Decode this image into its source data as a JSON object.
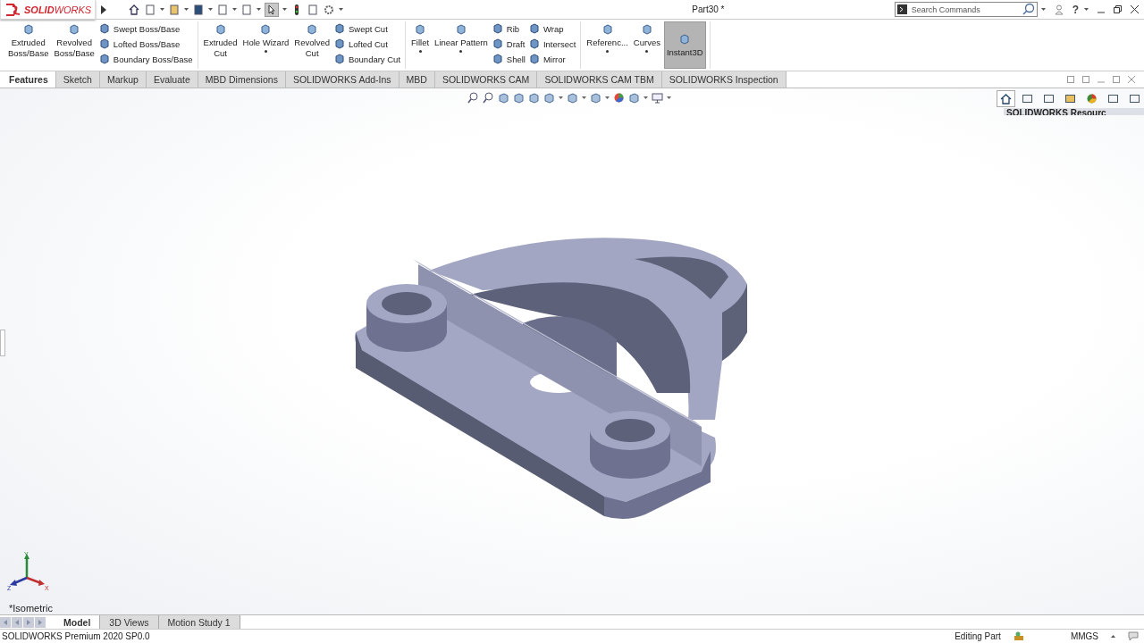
{
  "title_bar": {
    "logo": "**SOLID**WORKS",
    "title": "Part30 *",
    "search": {
      "placeholder": "Search Commands"
    },
    "help": "?"
  },
  "ribbon": [
    {
      "items": [
        {
          "kind": "large",
          "label": "Extruded Boss/Base"
        },
        {
          "kind": "large",
          "label": "Revolved Boss/Base"
        },
        {
          "kind": "stack",
          "entries": [
            "Swept Boss/Base",
            "Lofted Boss/Base",
            "Boundary Boss/Base"
          ]
        }
      ]
    },
    {
      "items": [
        {
          "kind": "large",
          "label": "Extruded Cut"
        },
        {
          "kind": "large",
          "label": "Hole Wizard",
          "dropdown": true
        },
        {
          "kind": "large",
          "label": "Revolved Cut"
        },
        {
          "kind": "stack",
          "entries": [
            "Swept Cut",
            "Lofted Cut",
            "Boundary Cut"
          ]
        }
      ]
    },
    {
      "items": [
        {
          "kind": "large",
          "label": "Fillet",
          "dropdown": true
        },
        {
          "kind": "large",
          "label": "Linear Pattern",
          "dropdown": true
        },
        {
          "kind": "stack",
          "entries": [
            "Rib",
            "Draft",
            "Shell"
          ]
        },
        {
          "kind": "stack",
          "entries": [
            "Wrap",
            "Intersect",
            "Mirror"
          ]
        }
      ]
    },
    {
      "items": [
        {
          "kind": "large",
          "label": "Referenc...",
          "dropdown": true
        },
        {
          "kind": "large",
          "label": "Curves",
          "dropdown": true
        },
        {
          "kind": "toggle",
          "label": "Instant3D",
          "selected": true
        }
      ]
    }
  ],
  "tabs": [
    {
      "label": "Features",
      "selected": true
    },
    {
      "label": "Sketch",
      "selected": false
    },
    {
      "label": "Markup",
      "selected": false
    },
    {
      "label": "Evaluate",
      "selected": false
    },
    {
      "label": "MBD Dimensions",
      "selected": false
    },
    {
      "label": "SOLIDWORKS Add-Ins",
      "selected": false
    },
    {
      "label": "MBD",
      "selected": false
    },
    {
      "label": "SOLIDWORKS CAM",
      "selected": false
    },
    {
      "label": "SOLIDWORKS CAM TBM",
      "selected": false
    },
    {
      "label": "SOLIDWORKS Inspection",
      "selected": false
    }
  ],
  "task_pane": {
    "tabs": [
      {
        "selected": true
      },
      {
        "selected": false
      },
      {
        "selected": false
      },
      {
        "selected": false
      },
      {
        "selected": false
      },
      {
        "selected": false
      },
      {
        "selected": false
      }
    ],
    "panel_title": "SOLIDWORKS Resourc"
  },
  "viewport": {
    "triad": [
      "Y",
      "Z",
      "X"
    ],
    "view_label": "*Isometric"
  },
  "bottom_tabs": [
    {
      "label": "Model",
      "selected": true
    },
    {
      "label": "3D Views",
      "selected": false
    },
    {
      "label": "Motion Study 1",
      "selected": false
    }
  ],
  "status_bar": {
    "product": "SOLIDWORKS Premium 2020 SP0.0",
    "mode": "Editing Part",
    "units": "MMGS"
  }
}
